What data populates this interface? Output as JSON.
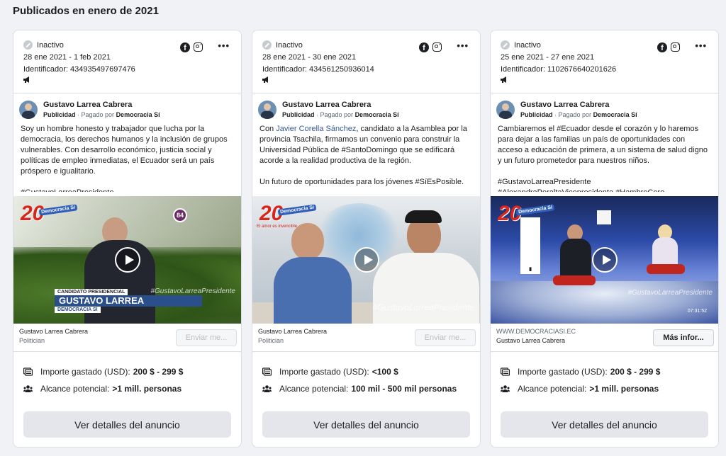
{
  "section_title": "Publicados en enero de 2021",
  "cards": [
    {
      "status": "Inactivo",
      "date_range": "28 ene 2021 - 1 feb 2021",
      "identifier": "Identificador: 434935497697476",
      "advertiser_name": "Gustavo Larrea Cabrera",
      "sponsor_prefix": "Publicidad · Pagado por",
      "sponsor": "Democracia Sí",
      "copy": "Soy un hombre honesto y trabajador que lucha por la democracia, los derechos humanos y la inclusión de grupos vulnerables. Con desarrollo económico, justicia social y políticas de empleo inmediatas, el Ecuador será un país próspero e igualitario.\n\n#GustavoLarreaPresidente…",
      "media_overlay_label": "CANDIDATO PRESIDENCIAL",
      "media_overlay_name": "GUSTAVO LARREA",
      "media_overlay_party": "DEMOCRACIA SÍ",
      "media_hashtag": "#GustavoLarreaPresidente",
      "media_number": "84",
      "cta_line1": "Gustavo Larrea Cabrera",
      "cta_line2": "Politician",
      "cta_button": "Enviar me...",
      "spend_label": "Importe gastado (USD):",
      "spend_value": "200 $ - 299 $",
      "reach_label": "Alcance potencial:",
      "reach_value": ">1 mill. personas",
      "details_button": "Ver detalles del anuncio"
    },
    {
      "status": "Inactivo",
      "date_range": "28 ene 2021 - 30 ene 2021",
      "identifier": "Identificador: 434561250936014",
      "advertiser_name": "Gustavo Larrea Cabrera",
      "sponsor_prefix": "Publicidad · Pagado por",
      "sponsor": "Democracia Sí",
      "copy_prefix": "Con ",
      "copy_link": "Javier Corella Sánchez",
      "copy": ", candidato a la Asamblea por la provincia Tsachila, firmamos un convenio para construir la Universidad Pública de #SantoDomingo que se edificará acorde a la realidad productiva de la región.\n\nUn futuro de oportunidades para los jóvenes #SíEsPosible.\n…",
      "media_tagline": "El amor es invencible",
      "media_hashtag": "#GustavoLarreaPresidente",
      "cta_line1": "Gustavo Larrea Cabrera",
      "cta_line2": "Politician",
      "cta_button": "Enviar me...",
      "spend_label": "Importe gastado (USD):",
      "spend_value": "<100 $",
      "reach_label": "Alcance potencial:",
      "reach_value": "100 mil - 500 mil personas",
      "details_button": "Ver detalles del anuncio"
    },
    {
      "status": "Inactivo",
      "date_range": "25 ene 2021 - 27 ene 2021",
      "identifier": "Identificador: 1102676640201626",
      "advertiser_name": "Gustavo Larrea Cabrera",
      "sponsor_prefix": "Publicidad · Pagado por",
      "sponsor": "Democracia Sí",
      "copy": "Cambiaremos el #Ecuador desde el corazón y lo haremos para dejar a las familias un país de oportunidades con acceso a educación de primera, a un sistema de salud digno y un futuro prometedor para nuestros niños.\n\n#GustavoLarreaPresidente\n#AlexandraPeraltaVicepresidenta #HambreCero…",
      "media_hashtag": "#GustavoLarreaPresidente",
      "media_time": "07:31:52",
      "cta_line1": "WWW.DEMOCRACIASI.EC",
      "cta_line2": "Gustavo Larrea Cabrera",
      "cta_button": "Más infor...",
      "spend_label": "Importe gastado (USD):",
      "spend_value": "200 $ - 299 $",
      "reach_label": "Alcance potencial:",
      "reach_value": ">1 mill. personas",
      "details_button": "Ver detalles del anuncio"
    }
  ],
  "media_badge_number": "20",
  "media_badge_si": "Democracia Sí"
}
